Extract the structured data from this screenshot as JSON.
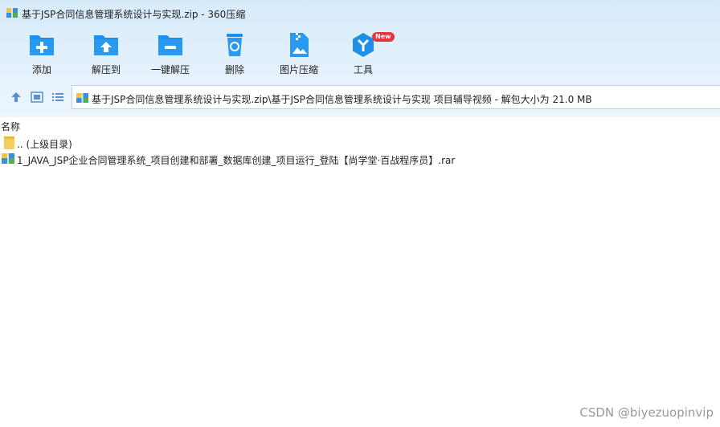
{
  "window": {
    "title": "基于JSP合同信息管理系统设计与实现.zip - 360压缩"
  },
  "toolbar": {
    "items": [
      {
        "label": "添加",
        "icon": "add-folder-icon"
      },
      {
        "label": "解压到",
        "icon": "extract-to-icon"
      },
      {
        "label": "一键解压",
        "icon": "one-click-extract-icon"
      },
      {
        "label": "删除",
        "icon": "recycle-bin-icon"
      },
      {
        "label": "图片压缩",
        "icon": "image-compress-icon"
      },
      {
        "label": "工具",
        "icon": "tools-icon",
        "badge": "New"
      }
    ]
  },
  "addressbar": {
    "path": "基于JSP合同信息管理系统设计与实现.zip\\基于JSP合同信息管理系统设计与实现 项目辅导视频 - 解包大小为 21.0 MB"
  },
  "filelist": {
    "column_name": "名称",
    "rows": [
      {
        "name": ".. (上级目录)",
        "icon": "folder-icon"
      },
      {
        "name": "1_JAVA_JSP企业合同管理系统_项目创建和部署_数据库创建_项目运行_登陆【尚学堂·百战程序员】.rar",
        "icon": "rar-archive-icon"
      }
    ]
  },
  "watermark": "CSDN @biyezuopinvip",
  "colors": {
    "accent": "#1e8fe8",
    "chrome_bg": "#dcedfb",
    "badge": "#e8323c"
  }
}
